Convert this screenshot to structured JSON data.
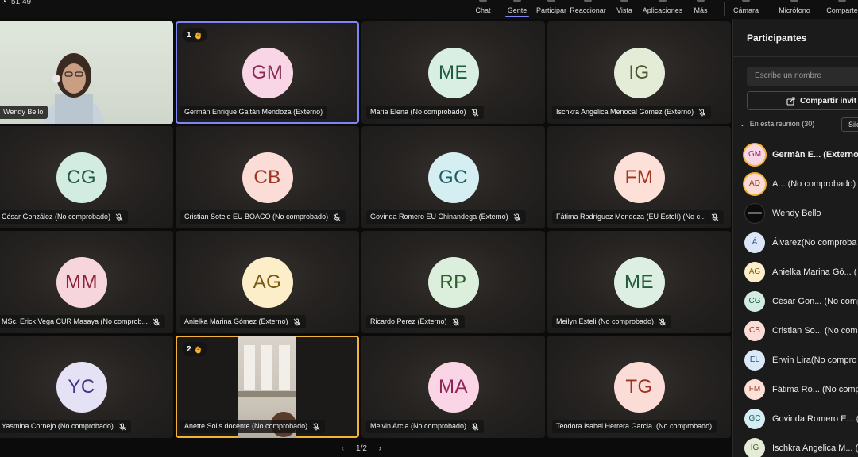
{
  "topbar": {
    "timer": "51:49",
    "items": [
      {
        "label": "Chat",
        "active": false
      },
      {
        "label": "Gente",
        "active": true
      },
      {
        "label": "Participar",
        "active": false
      },
      {
        "label": "Reaccionar",
        "active": false
      },
      {
        "label": "Vista",
        "active": false
      },
      {
        "label": "Aplicaciones",
        "active": false
      },
      {
        "label": "Más",
        "active": false
      },
      {
        "label": "Cámara",
        "active": false
      },
      {
        "label": "Micrófono",
        "active": false
      },
      {
        "label": "Comparte",
        "active": false
      }
    ]
  },
  "colors": {
    "accent": "#7f85f5",
    "raised_hand": "#f2b336"
  },
  "tiles": [
    {
      "name": "Wendy Bello",
      "initials": "",
      "video": true
    },
    {
      "name": "Germàn Enrique Gaitàn Mendoza (Externo)",
      "initials": "GM",
      "hand": "1",
      "speaking": true,
      "muted": false
    },
    {
      "name": "Maria Elena (No comprobado)",
      "initials": "ME",
      "muted": true
    },
    {
      "name": "Ischkra Angelica Menocal Gomez (Externo)",
      "initials": "IG",
      "muted": true
    },
    {
      "name": "César González (No comprobado)",
      "initials": "CG",
      "muted": true
    },
    {
      "name": "Cristian Sotelo EU BOACO (No comprobado)",
      "initials": "CB",
      "muted": true
    },
    {
      "name": "Govinda Romero EU Chinandega (Externo)",
      "initials": "GC",
      "muted": true
    },
    {
      "name": "Fátima Rodríguez Mendoza (EU Estelí) (No c...",
      "initials": "FM",
      "muted": true
    },
    {
      "name": "MSc. Erick Vega CUR Masaya (No comprob...",
      "initials": "MM",
      "muted": true
    },
    {
      "name": "Anielka Marina Gómez (Externo)",
      "initials": "AG",
      "muted": true
    },
    {
      "name": "Ricardo Perez (Externo)",
      "initials": "RP",
      "muted": true
    },
    {
      "name": "Meilyn Esteli (No comprobado)",
      "initials": "ME",
      "muted": true
    },
    {
      "name": "Yasmina Cornejo (No comprobado)",
      "initials": "YC",
      "muted": true
    },
    {
      "name": "Anette Solis docente (No comprobado)",
      "initials": "",
      "hand": "2",
      "raised": true,
      "video": true,
      "muted": true
    },
    {
      "name": "Melvin Arcia (No comprobado)",
      "initials": "MA",
      "muted": true
    },
    {
      "name": "Teodora Isabel Herrera Garcia. (No comprobado)",
      "initials": "TG",
      "muted": true
    }
  ],
  "pager": {
    "label": "1/2"
  },
  "panel": {
    "title": "Participantes",
    "search_placeholder": "Escribe un nombre",
    "share_label": "Compartir invit",
    "section_label": "En esta reunión (30)",
    "mute_label": "Sile",
    "participants": [
      {
        "initials": "GM",
        "name": "Germàn E...",
        "suffix": "(Externo)",
        "ring": true,
        "bold": true
      },
      {
        "initials": "AD",
        "name": "A...",
        "suffix": "(No comprobado)",
        "ring": true
      },
      {
        "initials": "",
        "name": "Wendy Bello",
        "suffix": ""
      },
      {
        "initials": "Á",
        "name": "Álvarez",
        "suffix": "(No comproba"
      },
      {
        "initials": "AG",
        "name": "Anielka Marina Gó...",
        "suffix": "("
      },
      {
        "initials": "CG",
        "name": "César Gon...",
        "suffix": "(No comp"
      },
      {
        "initials": "CB",
        "name": "Cristian So...",
        "suffix": "(No comp"
      },
      {
        "initials": "EL",
        "name": "Erwin Lira",
        "suffix": "(No compro"
      },
      {
        "initials": "FM",
        "name": "Fátima Ro...",
        "suffix": "(No comp"
      },
      {
        "initials": "GC",
        "name": "Govinda Romero E...",
        "suffix": "("
      },
      {
        "initials": "IG",
        "name": "Ischkra Angelica M...",
        "suffix": "("
      }
    ]
  }
}
